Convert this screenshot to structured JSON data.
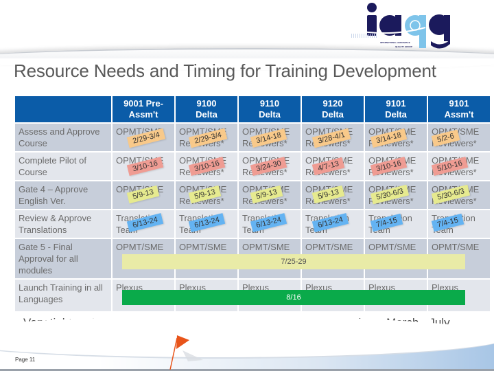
{
  "logo": {
    "name": "iaqg",
    "subtitle_line1": "INTERNATIONAL AEROSPACE",
    "subtitle_line2": "QUALITY GROUP",
    "colors": {
      "dark": "#1b1a5c",
      "light": "#7ec4ea"
    }
  },
  "title": "Resource Needs and Timing for Training Development",
  "table": {
    "headers": [
      "",
      "9001 Pre-\nAssm't",
      "9100\nDelta",
      "9110\nDelta",
      "9120\nDelta",
      "9101\nDelta",
      "9101\nAssm't"
    ],
    "header_lines": [
      [
        "",
        ""
      ],
      [
        "9001 Pre-",
        "Assm't"
      ],
      [
        "9100",
        "Delta"
      ],
      [
        "9110",
        "Delta"
      ],
      [
        "9120",
        "Delta"
      ],
      [
        "9101",
        "Delta"
      ],
      [
        "9101",
        "Assm't"
      ]
    ],
    "rows": [
      {
        "label": "Assess and Approve Course",
        "cells": [
          "OPMT/SME",
          "OPMT/SME Reviewers*",
          "OPMT/SME Reviewers*",
          "OPMT/SME Reviewers*",
          "OPMT/SME Reviewers*",
          "OPMT/SME Reviewers*"
        ],
        "notes": [
          "2/29-3/4",
          "2/29-3/4",
          "3/14-18",
          "3/28-4/1",
          "3/14-18",
          "5/2-6"
        ],
        "note_color": "orange"
      },
      {
        "label": "Complete Pilot of Course",
        "cells": [
          "OPMT/SME",
          "OPMT/SME Reviewers*",
          "OPMT/SME Reviewers*",
          "OPMT/SME Reviewers*",
          "OPMT/SME Reviewers*",
          "OPMT/SME Reviewers*"
        ],
        "notes": [
          "3/10-16",
          "3/10-16",
          "3/24-30",
          "4/7-13",
          "3/10-16",
          "5/10-16"
        ],
        "note_color": "red"
      },
      {
        "label": "Gate 4 – Approve English Ver.",
        "cells": [
          "OPMT/SME",
          "OPMT/SME Reviewers*",
          "OPMT/SME Reviewers*",
          "OPMT/SME Reviewers*",
          "OPMT/SME Reviewers*",
          "OPMT/SME Reviewers*"
        ],
        "notes": [
          "5/9-13",
          "5/9-13",
          "5/9-13",
          "5/9-13",
          "5/30-6/3",
          "5/30-6/3"
        ],
        "note_color": "yellow"
      },
      {
        "label": "Review & Approve Translations",
        "cells": [
          "Translation Team",
          "Translation Team",
          "Translation Team",
          "Translation Team",
          "Translation Team",
          "Translation Team"
        ],
        "notes": [
          "6/13-24",
          "6/13-24",
          "6/13-24",
          "6/13-24",
          "7/4-15",
          "7/4-15"
        ],
        "note_color": "blue"
      },
      {
        "label": "Gate 5 - Final Approval for all modules",
        "cells": [
          "OPMT/SME",
          "OPMT/SME",
          "OPMT/SME",
          "OPMT/SME",
          "OPMT/SME",
          "OPMT/SME"
        ]
      },
      {
        "label": "Launch Training in all Languages",
        "cells": [
          "Plexus",
          "Plexus",
          "Plexus",
          "Plexus",
          "Plexus",
          "Plexus"
        ]
      }
    ],
    "bars": {
      "gate5": "7/25-29",
      "launch": "8/16"
    }
  },
  "colors": {
    "header_bg": "#0b5ca8",
    "row_dark": "#c7ceda",
    "row_light": "#e3e6ec",
    "note_orange": "#f8c98a",
    "note_red": "#ef9c93",
    "note_yellow": "#e6ea8f",
    "note_blue": "#64b3f2",
    "bar_yellow": "#e9eba7",
    "bar_green": "#0aaa4a",
    "flag": "#e8541a"
  },
  "footer_note": "Very tight and stringent timeline……………………….makes for a busy March - July",
  "page_label": "Page 11"
}
